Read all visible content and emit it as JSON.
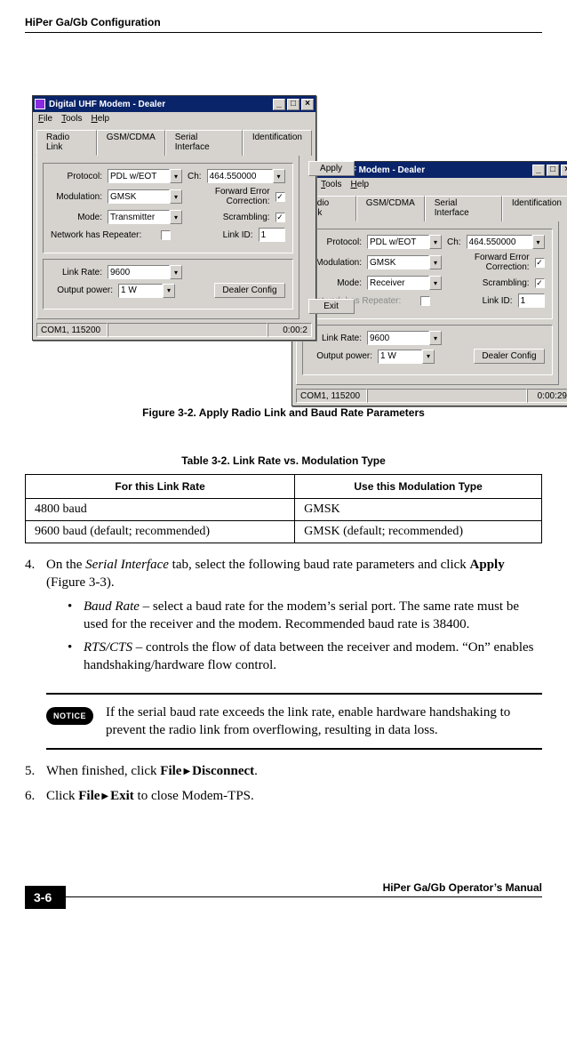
{
  "header": {
    "left": "HiPer Ga/Gb Configuration",
    "right": ""
  },
  "dialogs": {
    "title": "Digital UHF Modem  -  Dealer",
    "ctrl_min": "_",
    "ctrl_max": "□",
    "ctrl_close": "×",
    "menu": {
      "file": "File",
      "tools": "Tools",
      "help": "Help"
    },
    "tabs": {
      "radio": "Radio Link",
      "gsm": "GSM/CDMA",
      "serial": "Serial Interface",
      "ident": "Identification"
    },
    "labels": {
      "protocol": "Protocol:",
      "ch": "Ch:",
      "modulation": "Modulation:",
      "fec": "Forward Error Correction:",
      "mode": "Mode:",
      "scrambling": "Scrambling:",
      "repeater": "Network has Repeater:",
      "linkid": "Link ID:",
      "linkrate": "Link Rate:",
      "output": "Output power:"
    },
    "values": {
      "protocol": "PDL w/EOT",
      "ch": "464.550000",
      "modulation": "GMSK",
      "mode_tx": "Transmitter",
      "mode_rx": "Receiver",
      "linkid": "1",
      "linkrate": "9600",
      "output": "1 W"
    },
    "buttons": {
      "apply": "Apply",
      "dealer": "Dealer Config",
      "exit": "Exit"
    },
    "status": {
      "port": "COM1, 115200",
      "time_front": "0:00:2",
      "time_back": "0:00:29"
    }
  },
  "figure_caption": "Figure 3-2. Apply Radio Link and Baud Rate Parameters",
  "table": {
    "caption": "Table 3-2. Link Rate vs. Modulation Type",
    "headers": {
      "c1": "For this Link Rate",
      "c2": "Use this Modulation Type"
    },
    "rows": [
      {
        "c1": "4800 baud",
        "c2": "GMSK"
      },
      {
        "c1": "9600 baud  (default; recommended)",
        "c2": "GMSK (default; recommended)"
      }
    ]
  },
  "steps": {
    "s4_num": "4.",
    "s4_pre": "On the ",
    "s4_it": "Serial Interface",
    "s4_mid": " tab, select the following baud rate parameters and click ",
    "s4_bold": "Apply",
    "s4_post": " (Figure 3-3).",
    "b1_it": "Baud Rate",
    "b1_txt": " – select a baud rate for the modem’s serial port. The same rate must be used for the receiver and the modem. Recommended baud rate is 38400.",
    "b2_it": "RTS/CTS",
    "b2_txt": " – controls the flow of data between the receiver and modem. “On” enables handshaking/hardware flow control.",
    "notice_label": "NOTICE",
    "notice_txt": "If the serial baud rate exceeds the link rate, enable hardware handshaking to prevent the radio link from overflowing, resulting in data loss.",
    "s5_num": "5.",
    "s5_pre": "When finished, click ",
    "s5_m1": "File",
    "s5_m2": "Disconnect",
    "s5_post": ".",
    "s6_num": "6.",
    "s6_pre": "Click ",
    "s6_m1": "File",
    "s6_m2": "Exit",
    "s6_post": " to close Modem-TPS."
  },
  "footer": {
    "page": "3-6",
    "manual": "HiPer Ga/Gb Operator’s Manual"
  }
}
